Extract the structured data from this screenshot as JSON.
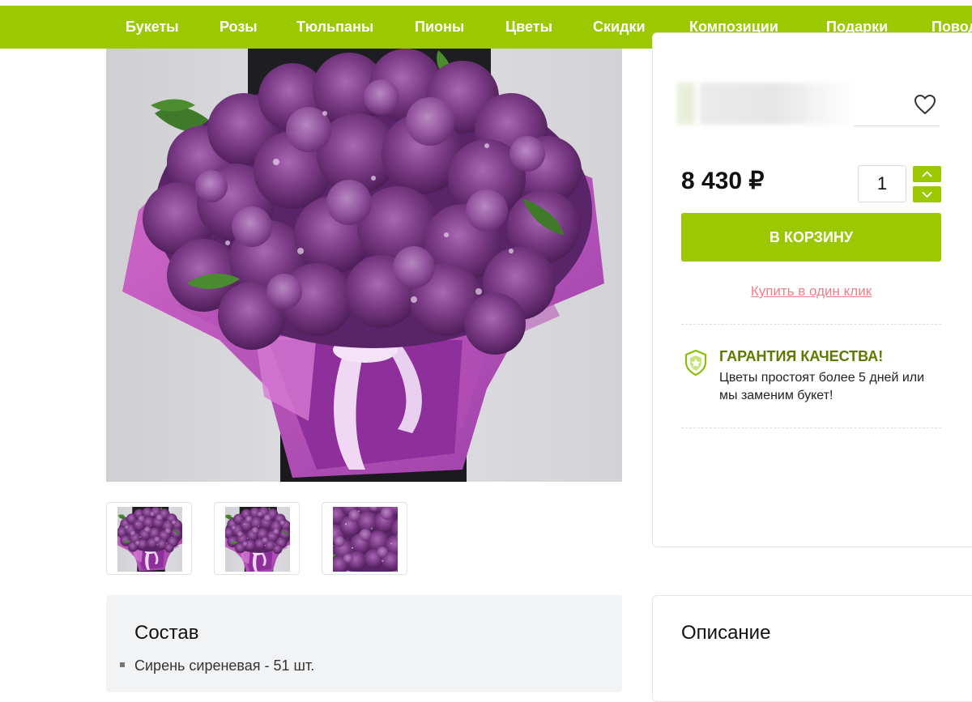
{
  "nav": {
    "items": [
      "Букеты",
      "Розы",
      "Тюльпаны",
      "Пионы",
      "Цветы",
      "Скидки",
      "Композиции",
      "Подарки",
      "Повод"
    ]
  },
  "product": {
    "image_alt": "Букет сирени",
    "thumbnails": [
      "thumbnail-1",
      "thumbnail-2",
      "thumbnail-3"
    ]
  },
  "purchase": {
    "price": "8 430 ₽",
    "quantity": "1",
    "add_to_cart": "В КОРЗИНУ",
    "one_click": "Купить в один клик"
  },
  "guarantee": {
    "title": "ГАРАНТИЯ КАЧЕСТВА!",
    "text": "Цветы простоят более 5 дней или мы заменим букет!"
  },
  "composition": {
    "title": "Состав",
    "items": [
      "Сирень сиреневая - 51 шт."
    ]
  },
  "description": {
    "title": "Описание"
  },
  "colors": {
    "accent": "#9bc800",
    "link": "#ef7f86",
    "guarantee_title": "#5c7a00"
  },
  "icons": {
    "favorite": "heart-icon",
    "increase": "chevron-up-icon",
    "decrease": "chevron-down-icon",
    "guarantee": "shield-icon"
  }
}
